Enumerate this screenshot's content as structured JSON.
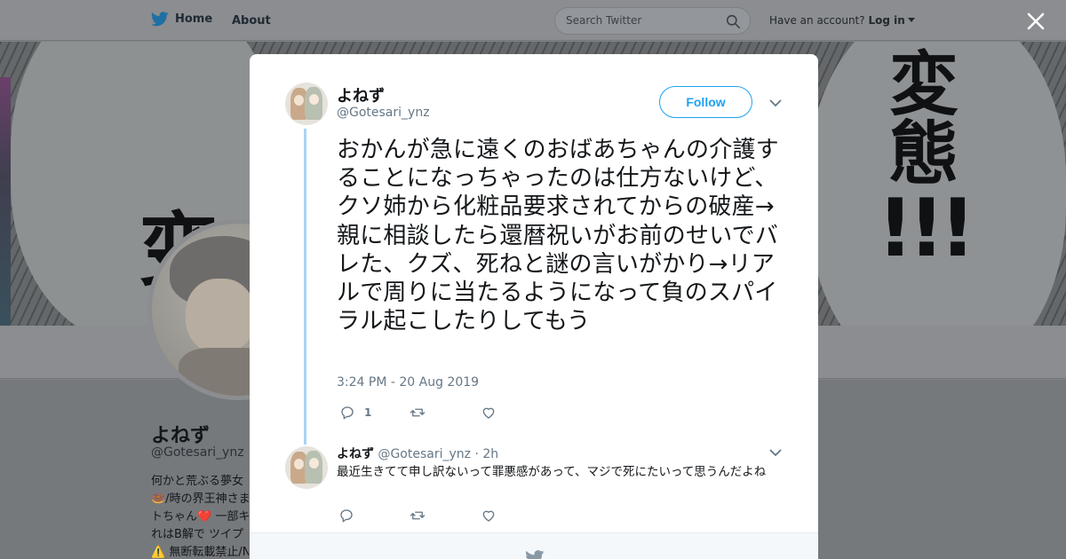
{
  "topnav": {
    "home_label": "Home",
    "about_label": "About",
    "search_placeholder": "Search Twitter",
    "have_account": "Have an account?",
    "login_label": "Log in"
  },
  "profile": {
    "name": "よねず",
    "handle": "@Gotesari_ynz",
    "bio_lines": [
      "何かと荒ぶる夢女",
      "🍩/時の界王神さま",
      "トちゃん❤️ 一部キ",
      "れはB解で ツイプ",
      "⚠️ 無断転載禁止/N"
    ]
  },
  "tweet": {
    "author_name": "よねず",
    "author_handle": "@Gotesari_ynz",
    "follow_label": "Follow",
    "text": "おかんが急に遠くのおばあちゃんの介護することになっちゃったのは仕方ないけど、クソ姉から化粧品要求されてからの破産→親に相談したら還暦祝いがお前のせいでバレた、クズ、死ねと謎の言いがかり→リアルで周りに当たるようになって負のスパイラル起こしたりしてもう",
    "timestamp": "3:24 PM - 20 Aug 2019",
    "reply_count": "1"
  },
  "reply": {
    "author_name": "よねず",
    "author_handle": "@Gotesari_ynz",
    "time": "· 2h",
    "text": "最近生きてて申し訳ないって罪悪感があって、マジで死にたいって思うんだよね"
  },
  "colors": {
    "accent": "#1da1f2",
    "thread_line": "#a9d4f4",
    "muted_text": "#657786",
    "overlay": "#7f8386"
  },
  "icons": [
    "twitter-bird-icon",
    "search-icon",
    "close-icon",
    "reply-icon",
    "retweet-icon",
    "like-icon",
    "chevron-down-icon"
  ]
}
